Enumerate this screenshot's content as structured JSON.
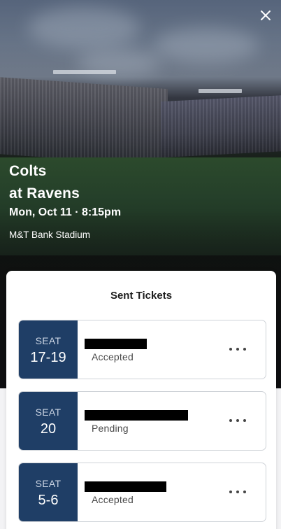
{
  "event": {
    "team_line1": "Colts",
    "team_line2": "at Ravens",
    "datetime": "Mon, Oct 11 · 8:15pm",
    "venue": "M&T Bank Stadium"
  },
  "sheet": {
    "title": "Sent Tickets"
  },
  "tickets": [
    {
      "seat_label": "SEAT",
      "seat": "17-19",
      "status": "Accepted"
    },
    {
      "seat_label": "SEAT",
      "seat": "20",
      "status": "Pending"
    },
    {
      "seat_label": "SEAT",
      "seat": "5-6",
      "status": "Accepted"
    }
  ],
  "colors": {
    "seat_box": "#1f3e66",
    "sheet_bg": "#ffffff",
    "page_bg": "#f3f3f5"
  },
  "icons": {
    "close": "close-icon",
    "more": "more-options-icon"
  }
}
